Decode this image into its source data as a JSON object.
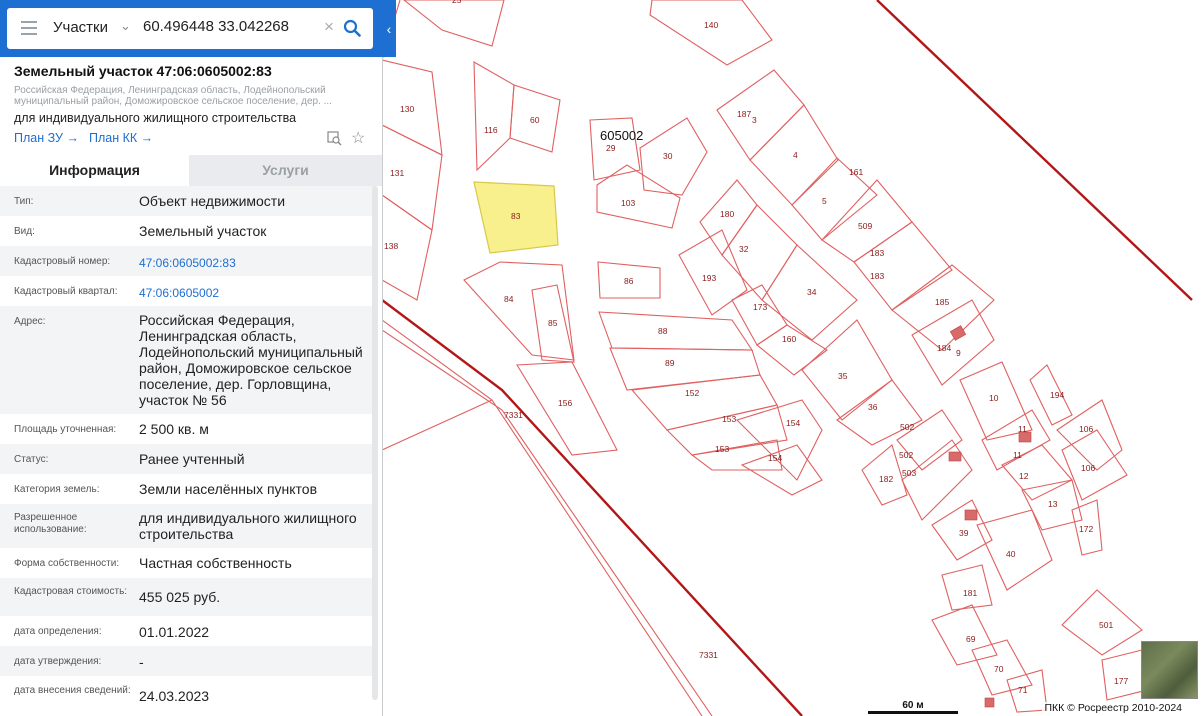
{
  "search": {
    "layer": "Участки",
    "query": "60.496448 33.042268"
  },
  "object": {
    "title": "Земельный участок 47:06:0605002:83",
    "address_short": "Российская Федерация, Ленинградская область, Лодейнопольский муниципальный район, Доможировское сельское поселение, дер. ...",
    "purpose": "для индивидуального жилищного строительства",
    "plan_zu": "План ЗУ",
    "plan_kk": "План КК"
  },
  "tabs": {
    "info": "Информация",
    "services": "Услуги"
  },
  "rows": [
    {
      "label": "Тип:",
      "value": "Объект недвижимости"
    },
    {
      "label": "Вид:",
      "value": "Земельный участок"
    },
    {
      "label": "Кадастровый номер:",
      "value": "47:06:0605002:83"
    },
    {
      "label": "Кадастровый квартал:",
      "value": "47:06:0605002"
    },
    {
      "label": "Адрес:",
      "value": "Российская Федерация, Ленинградская область, Лодейнопольский муниципальный район, Доможировское сельское поселение, дер. Горловщина, участок № 56"
    },
    {
      "label": "Площадь уточненная:",
      "value": "2 500 кв. м"
    },
    {
      "label": "Статус:",
      "value": "Ранее учтенный"
    },
    {
      "label": "Категория земель:",
      "value": "Земли населённых пунктов"
    },
    {
      "label": "Разрешенное использование:",
      "value": "для индивидуального жилищного строительства"
    },
    {
      "label": "Форма собственности:",
      "value": "Частная собственность"
    },
    {
      "label": "Кадастровая стоимость:",
      "value": "455 025 руб."
    },
    {
      "label": "дата определения:",
      "value": "01.01.2022"
    },
    {
      "label": "дата утверждения:",
      "value": "-"
    },
    {
      "label": "дата внесения сведений:",
      "value": "24.03.2023"
    }
  ],
  "map": {
    "quarter_label": "605002",
    "scale_label": "60 м",
    "attribution": "ПКК © Росреестр 2010-2024",
    "parcel_labels": [
      "25",
      "140",
      "130",
      "116",
      "60",
      "29",
      "30",
      "187",
      "3",
      "4",
      "131",
      "83",
      "103",
      "161",
      "5",
      "180",
      "32",
      "509",
      "183",
      "138",
      "193",
      "183",
      "84",
      "86",
      "34",
      "173",
      "85",
      "185",
      "160",
      "88",
      "184",
      "9",
      "89",
      "35",
      "36",
      "7331",
      "156",
      "152",
      "10",
      "194",
      "153",
      "154",
      "11",
      "106",
      "502",
      "153",
      "154",
      "11",
      "182",
      "502",
      "503",
      "12",
      "106",
      "13",
      "39",
      "40",
      "172",
      "181",
      "501",
      "69",
      "70",
      "71",
      "177",
      "7331"
    ],
    "selected_parcel": "83",
    "colors": {
      "boundary": "#e06060",
      "road": "#b31616",
      "selected_fill": "#f7f08c",
      "accent": "#1d6fd1"
    }
  }
}
